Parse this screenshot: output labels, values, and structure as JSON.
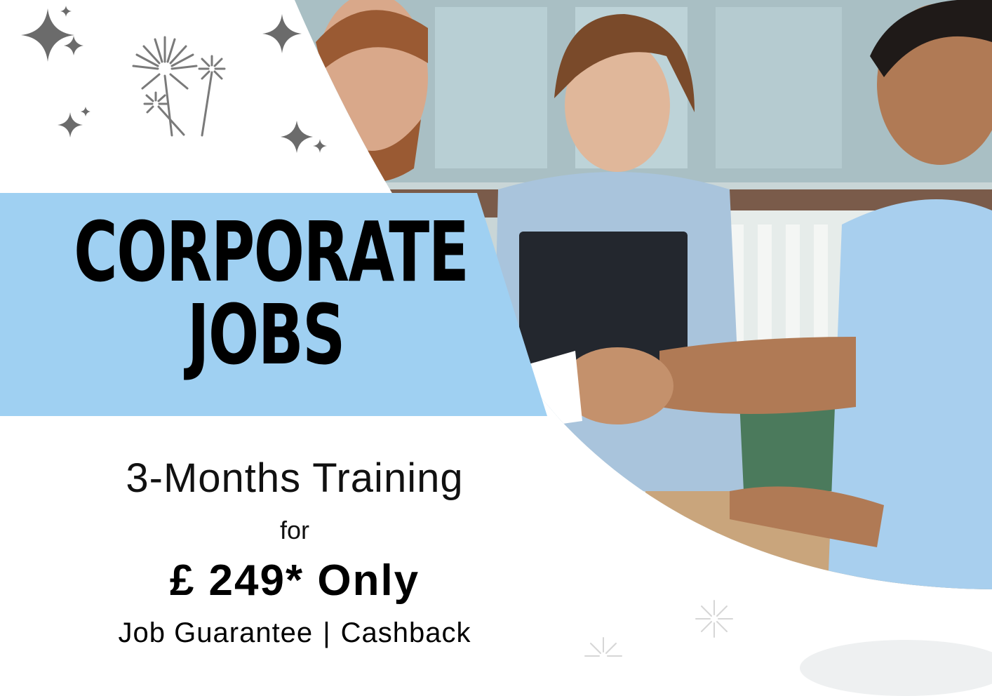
{
  "headline": {
    "line1": "CORPORATE",
    "line2": "JOBS"
  },
  "offer": {
    "duration": "3-Months Training",
    "connector": "for",
    "price": "£ 249* Only",
    "benefit_1": "Job Guarantee",
    "separator": "|",
    "benefit_2": "Cashback"
  },
  "colors": {
    "banner": "#9fd0f2",
    "text": "#000000",
    "background": "#ffffff",
    "sparkle": "#6b6b6b"
  },
  "icons": [
    "sparkle-icon",
    "firework-icon"
  ]
}
